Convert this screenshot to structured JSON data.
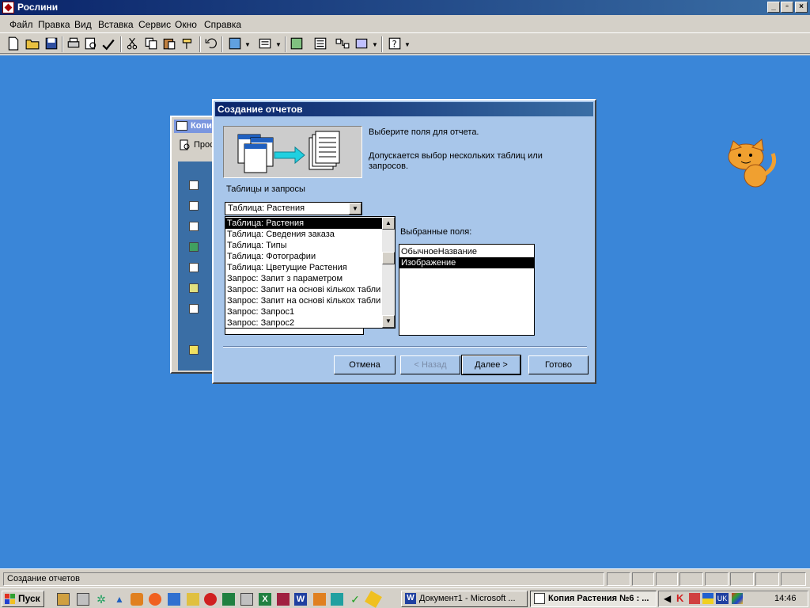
{
  "window": {
    "title": "Рослини"
  },
  "menu": [
    "Файл",
    "Правка",
    "Вид",
    "Вставка",
    "Сервис",
    "Окно",
    "Справка"
  ],
  "db_window": {
    "title": "Копия",
    "toolbar_label": "Прос"
  },
  "dialog": {
    "title": "Создание отчетов",
    "prompt": "Выберите поля для отчета.",
    "hint": "Допускается выбор нескольких таблиц или запросов.",
    "tables_label": "Таблицы и запросы",
    "combo_value": "Таблица: Растения",
    "dropdown_items": [
      "Таблица: Растения",
      "Таблица: Сведения заказа",
      "Таблица: Типы",
      "Таблица: Фотографии",
      "Таблица: Цветущие Растения",
      "Запрос: Запит з параметром",
      "Запрос: Запит на основі кількох табли",
      "Запрос: Запит на основі кількох табли",
      "Запрос: Запрос1",
      "Запрос: Запрос2"
    ],
    "selected_fields_label": "Выбранные поля:",
    "selected_fields": [
      "ОбычноеНазвание",
      "Изображение"
    ],
    "buttons": {
      "cancel": "Отмена",
      "back": "< Назад",
      "next": "Далее >",
      "finish": "Готово"
    }
  },
  "statusbar": {
    "text": "Создание отчетов"
  },
  "taskbar": {
    "start": "Пуск",
    "tasks": [
      "Документ1 - Microsoft ...",
      "Копия Растения №6 : ..."
    ],
    "clock": "14:46",
    "lang": "UK"
  },
  "colors": {
    "desktop": "#3a86d8",
    "dialog_bg": "#a8c6ea",
    "title_bar": "#0a246a"
  }
}
